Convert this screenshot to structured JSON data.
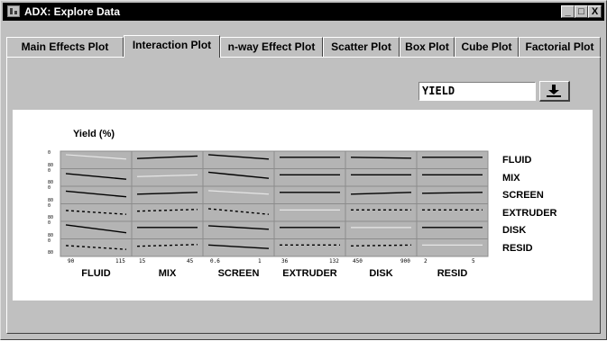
{
  "window": {
    "title": "ADX: Explore Data",
    "controls": [
      "_",
      "□",
      "X"
    ]
  },
  "tabs": [
    {
      "label": "Main Effects Plot",
      "active": false
    },
    {
      "label": "Interaction Plot",
      "active": true
    },
    {
      "label": "n-way Effect Plot",
      "active": false
    },
    {
      "label": "Scatter Plot",
      "active": false
    },
    {
      "label": "Box Plot",
      "active": false
    },
    {
      "label": "Cube Plot",
      "active": false
    },
    {
      "label": "Factorial Plot",
      "active": false
    }
  ],
  "response": {
    "selected": "YIELD",
    "button_icon": "dropdown-arrow-icon"
  },
  "plot": {
    "y_title": "Yield (%)",
    "y_ticks": [
      "0",
      "80"
    ],
    "row_factors": [
      "FLUID",
      "MIX",
      "SCREEN",
      "EXTRUDER",
      "DISK",
      "RESID"
    ],
    "col_factors": [
      {
        "name": "FLUID",
        "low": "90",
        "high": "115"
      },
      {
        "name": "MIX",
        "low": "15",
        "high": "45"
      },
      {
        "name": "SCREEN",
        "low": "0.6",
        "high": "1"
      },
      {
        "name": "EXTRUDER",
        "low": "36",
        "high": "132"
      },
      {
        "name": "DISK",
        "low": "450",
        "high": "900"
      },
      {
        "name": "RESID",
        "low": "2",
        "high": "5"
      }
    ],
    "colors": {
      "cell": "#b4b4b4",
      "cell_border": "#8c8c8c",
      "line": "#000000",
      "diag_line": "#e6e6e6"
    }
  },
  "chart_data": {
    "type": "line",
    "title": "",
    "ylabel": "Yield (%)",
    "ylim": [
      0,
      80
    ],
    "rows": [
      "FLUID",
      "MIX",
      "SCREEN",
      "EXTRUDER",
      "DISK",
      "RESID"
    ],
    "cols": [
      "FLUID",
      "MIX",
      "SCREEN",
      "EXTRUDER",
      "DISK",
      "RESID"
    ],
    "cells": [
      [
        {
          "diag": true,
          "y": [
            70,
            45
          ]
        },
        {
          "y": [
            48,
            62
          ],
          "style": "solid"
        },
        {
          "y": [
            70,
            45
          ],
          "style": "solid"
        },
        {
          "y": [
            55,
            55
          ],
          "style": "solid"
        },
        {
          "y": [
            55,
            50
          ],
          "style": "solid"
        },
        {
          "y": [
            55,
            55
          ],
          "style": "solid"
        }
      ],
      [
        {
          "y": [
            62,
            30
          ],
          "style": "solid"
        },
        {
          "diag": true,
          "y": [
            45,
            55
          ]
        },
        {
          "y": [
            70,
            35
          ],
          "style": "solid"
        },
        {
          "y": [
            55,
            55
          ],
          "style": "solid"
        },
        {
          "y": [
            55,
            55
          ],
          "style": "solid"
        },
        {
          "y": [
            55,
            55
          ],
          "style": "solid"
        }
      ],
      [
        {
          "y": [
            62,
            30
          ],
          "style": "solid"
        },
        {
          "y": [
            45,
            55
          ],
          "style": "solid"
        },
        {
          "diag": true,
          "y": [
            65,
            45
          ]
        },
        {
          "y": [
            55,
            55
          ],
          "style": "solid"
        },
        {
          "y": [
            45,
            55
          ],
          "style": "solid"
        },
        {
          "y": [
            50,
            55
          ],
          "style": "solid"
        }
      ],
      [
        {
          "y": [
            52,
            30
          ],
          "style": "dashed"
        },
        {
          "y": [
            48,
            58
          ],
          "style": "dashed"
        },
        {
          "y": [
            62,
            30
          ],
          "style": "dashed"
        },
        {
          "diag": true,
          "y": [
            55,
            55
          ]
        },
        {
          "y": [
            55,
            55
          ],
          "style": "dashed"
        },
        {
          "y": [
            55,
            55
          ],
          "style": "dashed"
        }
      ],
      [
        {
          "y": [
            70,
            25
          ],
          "style": "solid"
        },
        {
          "y": [
            55,
            55
          ],
          "style": "solid"
        },
        {
          "y": [
            65,
            45
          ],
          "style": "solid"
        },
        {
          "y": [
            55,
            55
          ],
          "style": "solid"
        },
        {
          "diag": true,
          "y": [
            55,
            55
          ]
        },
        {
          "y": [
            55,
            55
          ],
          "style": "solid"
        }
      ],
      [
        {
          "y": [
            52,
            30
          ],
          "style": "dashed"
        },
        {
          "y": [
            48,
            58
          ],
          "style": "dashed"
        },
        {
          "y": [
            55,
            35
          ],
          "style": "solid"
        },
        {
          "y": [
            55,
            55
          ],
          "style": "dashed"
        },
        {
          "y": [
            50,
            55
          ],
          "style": "dashed"
        },
        {
          "diag": true,
          "y": [
            55,
            55
          ]
        }
      ]
    ]
  }
}
